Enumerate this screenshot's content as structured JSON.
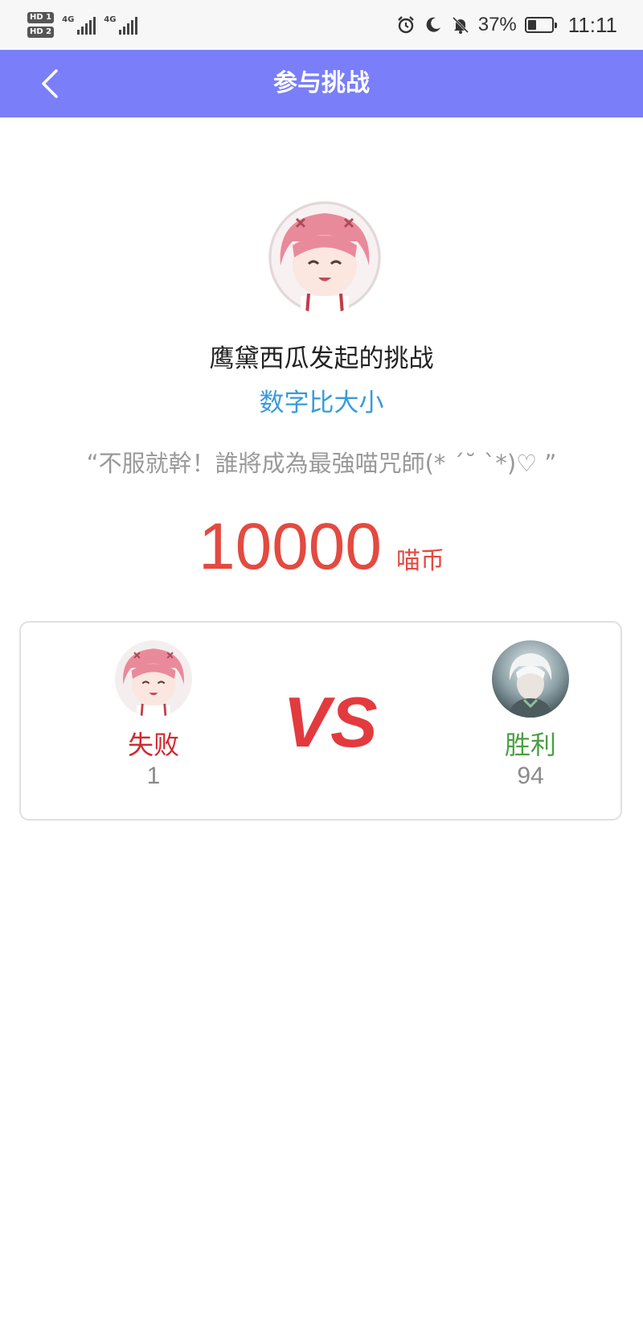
{
  "status_bar": {
    "sim1_label": "HD 1",
    "sim2_label": "HD 2",
    "net1": "4G",
    "net2": "4G",
    "battery_percent": "37%",
    "battery_level": 0.37,
    "time": "11:11",
    "icons": [
      "alarm-icon",
      "moon-icon",
      "bell-off-icon",
      "battery-icon"
    ]
  },
  "header": {
    "title": "参与挑战",
    "back_icon": "chevron-left-icon",
    "background": "#7a7ef8"
  },
  "challenge": {
    "host_name": "鹰黛西瓜发起的挑战",
    "game": "数字比大小",
    "slogan": "“不服就幹！誰將成為最強喵咒師(*  ´˘  `*)♡ ”",
    "stake_amount": "10000",
    "stake_unit": "喵币"
  },
  "match": {
    "vs_label": "VS",
    "left_player": {
      "result": "失败",
      "score": "1"
    },
    "right_player": {
      "result": "胜利",
      "score": "94"
    }
  },
  "colors": {
    "accent": "#7a7ef8",
    "lose": "#d0282e",
    "win": "#4aa043",
    "stake": "#e34a40",
    "game_link": "#3a9bd8"
  }
}
